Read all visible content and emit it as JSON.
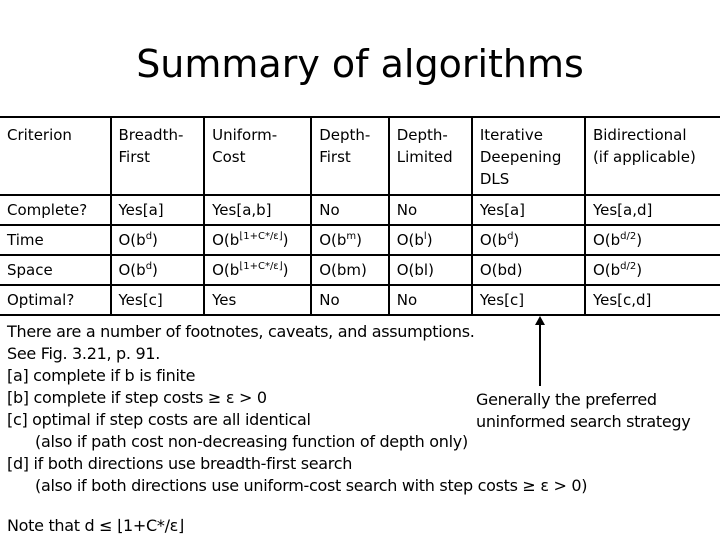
{
  "title": "Summary of algorithms",
  "table": {
    "headers": [
      "Criterion",
      "Breadth-\nFirst",
      "Uniform-\nCost",
      "Depth-\nFirst",
      "Depth-\nLimited",
      "Iterative\nDeepening\nDLS",
      "Bidirectional\n(if applicable)"
    ],
    "rows": [
      {
        "label": "Complete?",
        "cells": [
          {
            "pre": "Yes[a]"
          },
          {
            "pre": "Yes[a,b]"
          },
          {
            "pre": "No"
          },
          {
            "pre": "No"
          },
          {
            "pre": "Yes[a]"
          },
          {
            "pre": "Yes[a,d]"
          }
        ]
      },
      {
        "label": "Time",
        "cells": [
          {
            "pre": "O(b",
            "sup": "d",
            "post": ")"
          },
          {
            "pre": "O(b",
            "sup": "⌊1+C*/ε⌋",
            "post": ")"
          },
          {
            "pre": "O(b",
            "sup": "m",
            "post": ")"
          },
          {
            "pre": "O(b",
            "sup": "l",
            "post": ")"
          },
          {
            "pre": "O(b",
            "sup": "d",
            "post": ")"
          },
          {
            "pre": "O(b",
            "sup": "d/2",
            "post": ")"
          }
        ]
      },
      {
        "label": "Space",
        "cells": [
          {
            "pre": "O(b",
            "sup": "d",
            "post": ")"
          },
          {
            "pre": "O(b",
            "sup": "⌊1+C*/ε⌋",
            "post": ")"
          },
          {
            "pre": "O(bm)"
          },
          {
            "pre": "O(bl)"
          },
          {
            "pre": "O(bd)"
          },
          {
            "pre": "O(b",
            "sup": "d/2",
            "post": ")"
          }
        ]
      },
      {
        "label": "Optimal?",
        "cells": [
          {
            "pre": "Yes[c]"
          },
          {
            "pre": "Yes"
          },
          {
            "pre": "No"
          },
          {
            "pre": "No"
          },
          {
            "pre": "Yes[c]"
          },
          {
            "pre": "Yes[c,d]"
          }
        ]
      }
    ]
  },
  "notes": [
    {
      "text": "There are a number of footnotes, caveats, and assumptions."
    },
    {
      "text": "See Fig. 3.21, p. 91."
    },
    {
      "text": "[a] complete if b is finite"
    },
    {
      "text": "[b] complete if step costs ≥ ε > 0"
    },
    {
      "text": "[c] optimal if step costs are all identical"
    },
    {
      "text": "(also if path cost non-decreasing function of depth only)",
      "indent": true
    },
    {
      "text": "[d] if both directions use breadth-first search"
    },
    {
      "text": "(also if both directions use uniform-cost search with step costs ≥ ε > 0)",
      "indent": true
    }
  ],
  "callout": [
    "Generally the preferred",
    "uninformed search strategy"
  ],
  "footer_note": "Note that d ≤ ⌊1+C*/ε⌋"
}
